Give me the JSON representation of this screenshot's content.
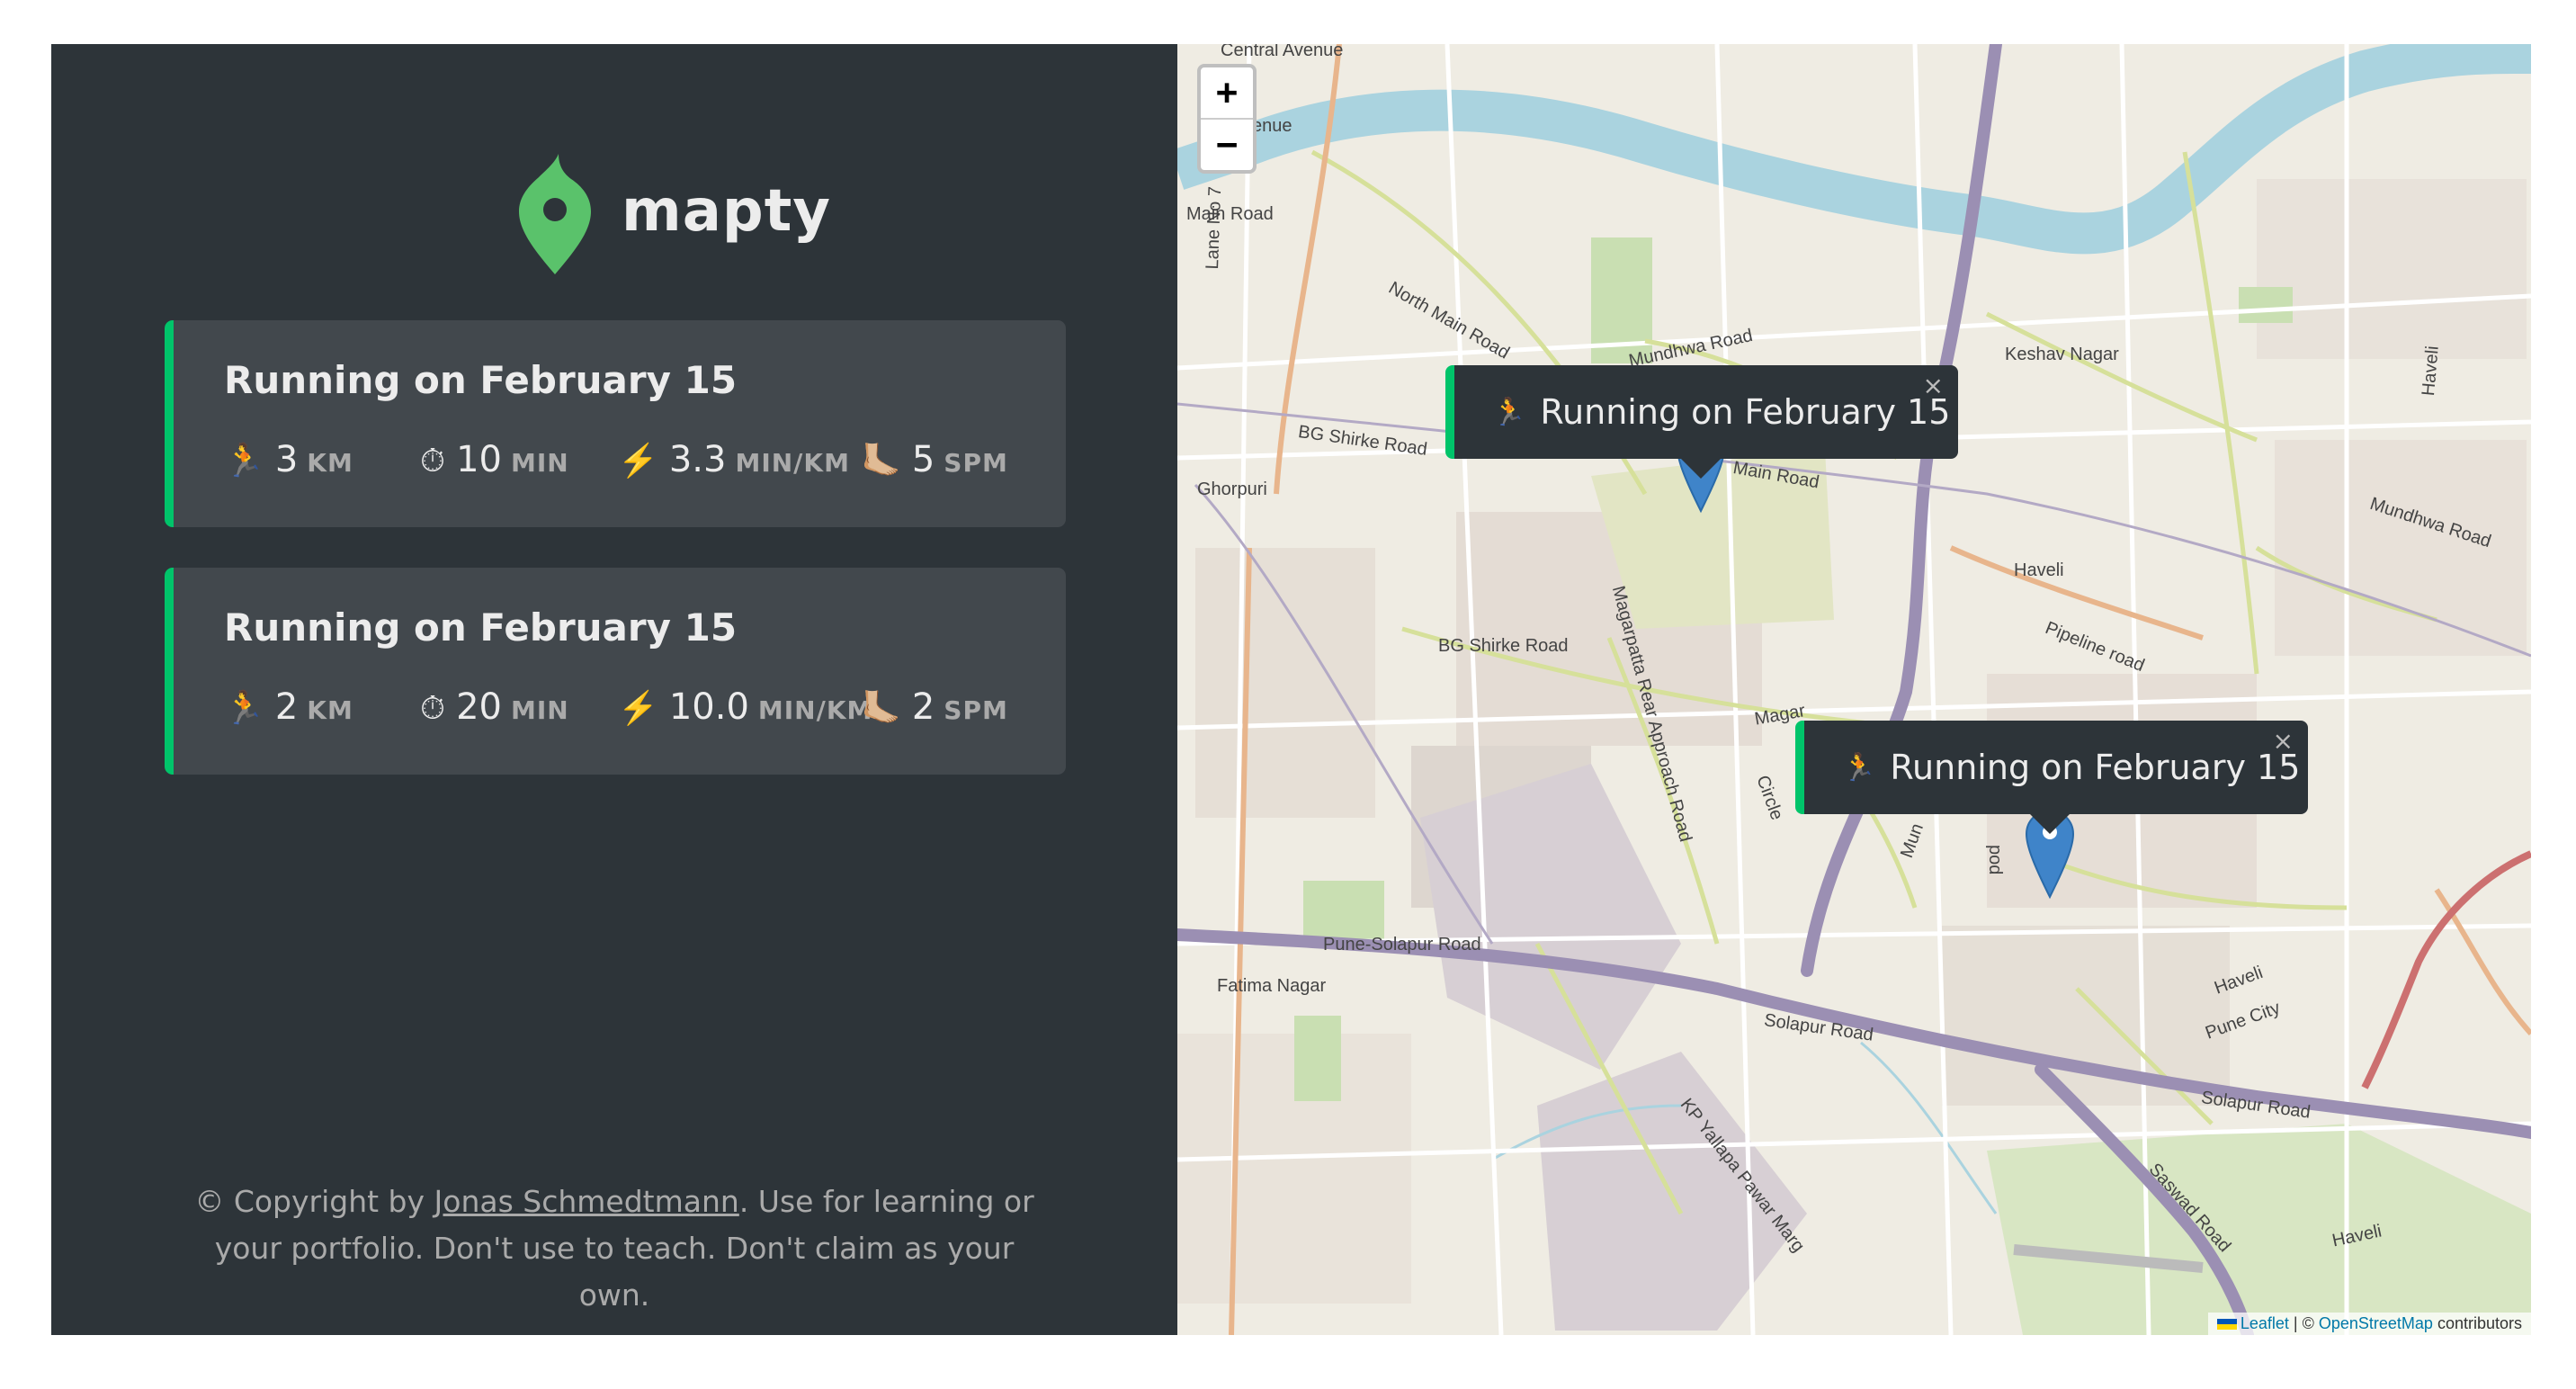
{
  "logo": {
    "text": "mapty",
    "icon": "map-pin-icon",
    "color": "#00c46a"
  },
  "workouts": [
    {
      "title": "Running on February 15",
      "type_icon": "🏃",
      "distance": {
        "icon": "🏃",
        "value": "3",
        "unit": "KM"
      },
      "duration": {
        "icon": "⏱",
        "value": "10",
        "unit": "MIN"
      },
      "pace": {
        "icon": "⚡️",
        "value": "3.3",
        "unit": "MIN/KM"
      },
      "cadence": {
        "icon": "🦶🏼",
        "value": "5",
        "unit": "SPM"
      }
    },
    {
      "title": "Running on February 15",
      "type_icon": "🏃",
      "distance": {
        "icon": "🏃",
        "value": "2",
        "unit": "KM"
      },
      "duration": {
        "icon": "⏱",
        "value": "20",
        "unit": "MIN"
      },
      "pace": {
        "icon": "⚡️",
        "value": "10.0",
        "unit": "MIN/KM"
      },
      "cadence": {
        "icon": "🦶🏼",
        "value": "2",
        "unit": "SPM"
      }
    }
  ],
  "footer": {
    "prefix": "© Copyright by ",
    "author": "Jonas Schmedtmann",
    "suffix": ". Use for learning or your portfolio. Don't use to teach. Don't claim as your own."
  },
  "map": {
    "zoom_in": "+",
    "zoom_out": "−",
    "popups": [
      {
        "icon": "🏃",
        "text": "Running on February 15",
        "close": "×"
      },
      {
        "icon": "🏃",
        "text": "Running on February 15",
        "close": "×"
      }
    ],
    "attribution": {
      "leaflet": "Leaflet",
      "sep": " | © ",
      "osm": "OpenStreetMap",
      "tail": " contributors"
    },
    "labels": {
      "central_avenue": "Central Avenue",
      "avenue": "Avenue",
      "main_road": "Main Road",
      "lane_no_7": "Lane No 7",
      "north_main_road": "North Main Road",
      "mundhwa_road": "Mundhwa Road",
      "keshav_nagar": "Keshav Nagar",
      "haveli_1": "Haveli",
      "bg_shirke_road_1": "BG Shirke Road",
      "ghorpuri": "Ghorpuri",
      "main_road_2": "Main Road",
      "mundhwa_road_2": "Mundhwa Road",
      "haveli_2": "Haveli",
      "pipeline_road": "Pipeline road",
      "bg_shirke_road_2": "BG Shirke Road",
      "magarpatta": "Magarpatta Rear Approach Road",
      "magar": "Magar",
      "circle": "Circle",
      "pune_solapur_road": "Pune-Solapur Road",
      "fatima_nagar": "Fatima Nagar",
      "solapur_road_1": "Solapur Road",
      "haveli_3": "Haveli",
      "pune_city": "Pune City",
      "solapur_road_2": "Solapur Road",
      "kp_yallapa": "KP Yallapa Pawar Marg",
      "saswad_road": "Saswad Road",
      "haveli_4": "Haveli",
      "mun": "Mun",
      "pod": "pod"
    }
  }
}
